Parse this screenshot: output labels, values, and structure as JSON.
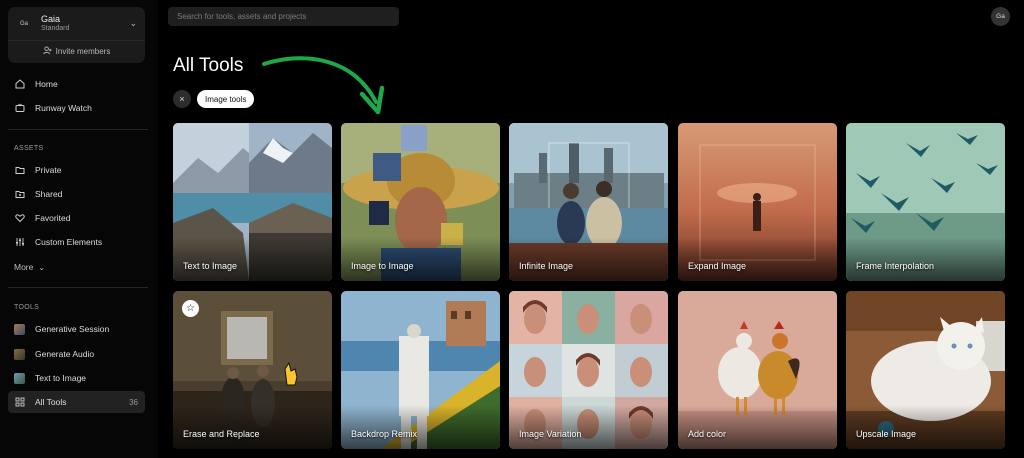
{
  "workspace": {
    "avatar": "Ga",
    "name": "Gaia",
    "plan": "Standard",
    "invite_label": "Invite members"
  },
  "nav": {
    "top": [
      {
        "label": "Home",
        "icon": "home-icon"
      },
      {
        "label": "Runway Watch",
        "icon": "tv-icon"
      }
    ],
    "assets_label": "ASSETS",
    "assets": [
      {
        "label": "Private",
        "icon": "folder-icon"
      },
      {
        "label": "Shared",
        "icon": "share-icon"
      },
      {
        "label": "Favorited",
        "icon": "heart-icon"
      },
      {
        "label": "Custom Elements",
        "icon": "sliders-icon"
      },
      {
        "label": "More",
        "icon": "chevron-down-icon"
      }
    ],
    "tools_label": "TOOLS",
    "tools": [
      {
        "label": "Generative Session"
      },
      {
        "label": "Generate Audio"
      },
      {
        "label": "Text to Image"
      },
      {
        "label": "All Tools",
        "count": "36"
      }
    ]
  },
  "search": {
    "placeholder": "Search for tools, assets and projects"
  },
  "user": {
    "avatar": "Ga"
  },
  "page": {
    "title": "All Tools"
  },
  "filter": {
    "close_icon": "×",
    "chip_label": "Image tools"
  },
  "cards": [
    {
      "label": "Text to Image"
    },
    {
      "label": "Image to Image"
    },
    {
      "label": "Infinite Image"
    },
    {
      "label": "Expand Image"
    },
    {
      "label": "Frame Interpolation"
    },
    {
      "label": "Erase and Replace"
    },
    {
      "label": "Backdrop Remix"
    },
    {
      "label": "Image Variation"
    },
    {
      "label": "Add color"
    },
    {
      "label": "Upscale Image"
    }
  ],
  "colors": {
    "accent_arrow": "#1fa84a",
    "background": "#000000",
    "sidebar_active": "#222222"
  }
}
